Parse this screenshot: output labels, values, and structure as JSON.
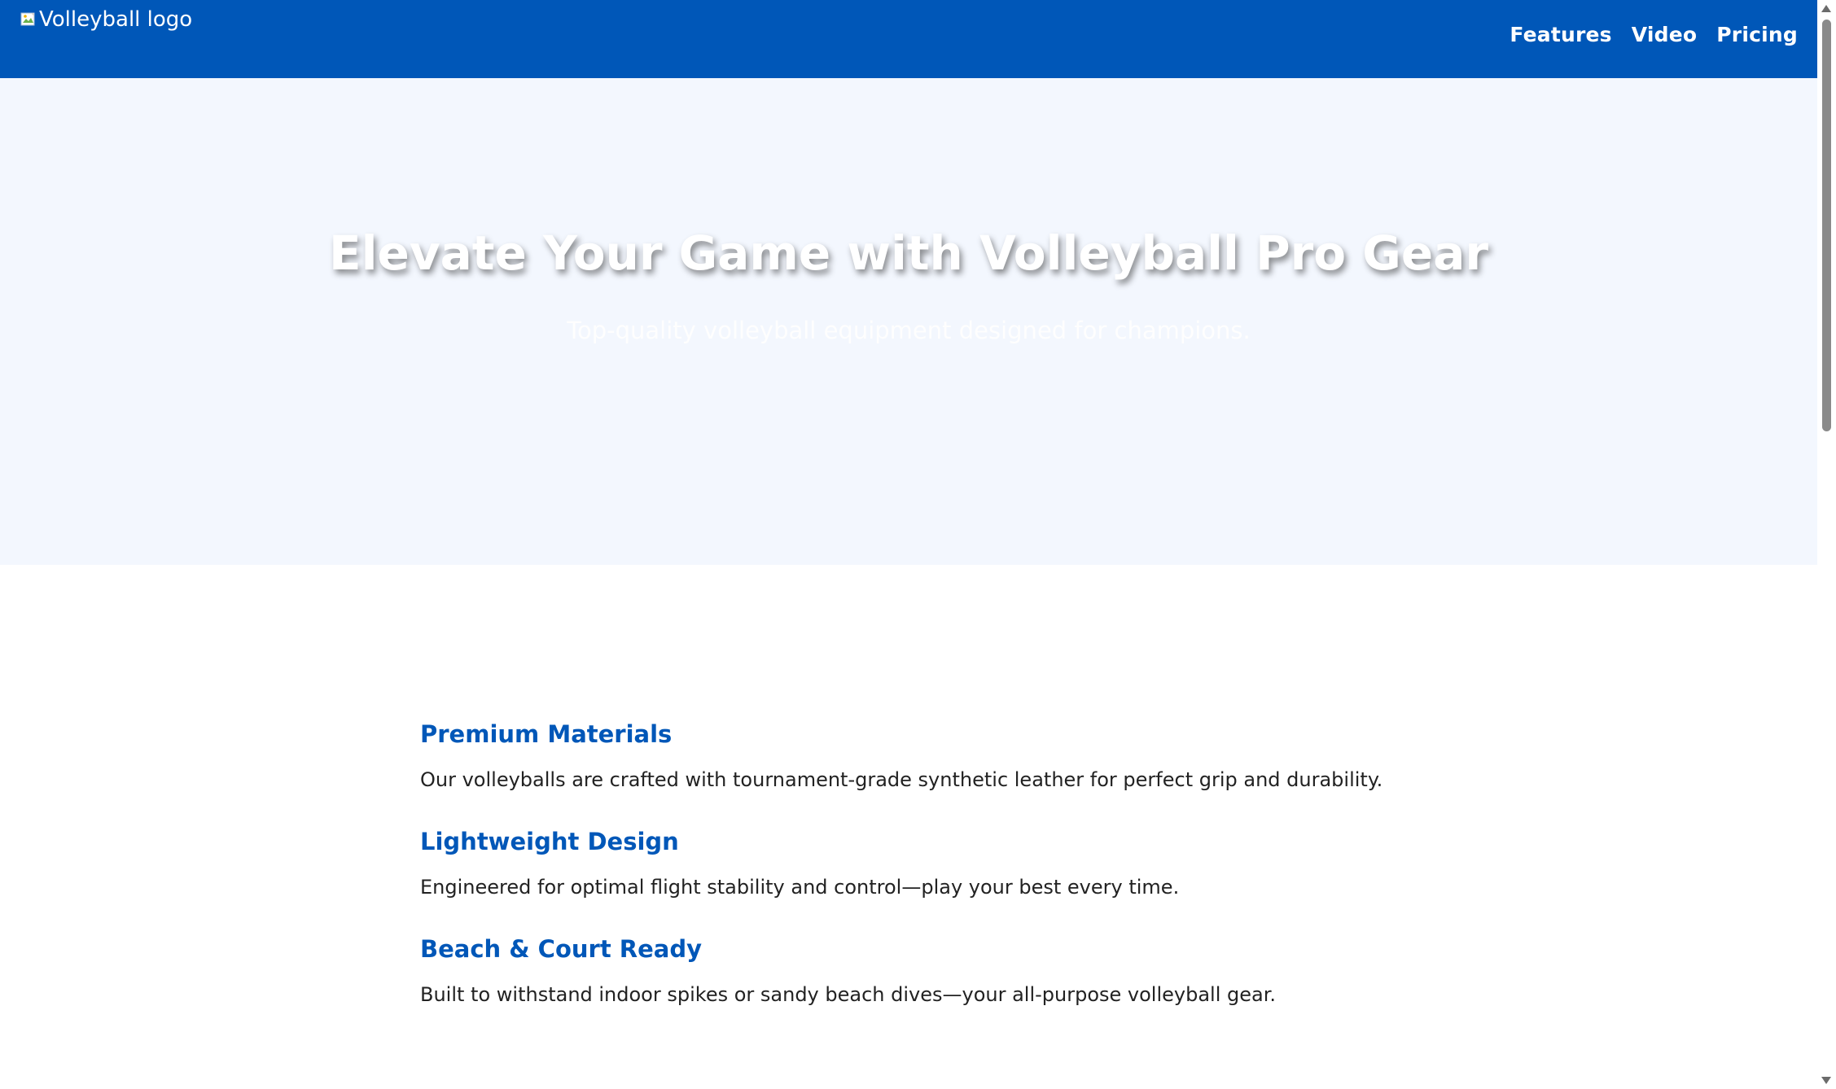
{
  "header": {
    "logo_alt": "Volleyball logo",
    "nav": {
      "features": "Features",
      "video": "Video",
      "pricing": "Pricing"
    }
  },
  "hero": {
    "title": "Elevate Your Game with Volleyball Pro Gear",
    "subtitle": "Top-quality volleyball equipment designed for champions."
  },
  "features": [
    {
      "title": "Premium Materials",
      "description": "Our volleyballs are crafted with tournament-grade synthetic leather for perfect grip and durability."
    },
    {
      "title": "Lightweight Design",
      "description": "Engineered for optimal flight stability and control—play your best every time."
    },
    {
      "title": "Beach & Court Ready",
      "description": "Built to withstand indoor spikes or sandy beach dives—your all-purpose volleyball gear."
    }
  ],
  "colors": {
    "brand_blue": "#0057b8",
    "hero_background": "#f3f7fe",
    "body_text": "#222222"
  },
  "icons": {
    "logo": "broken-image-icon"
  }
}
